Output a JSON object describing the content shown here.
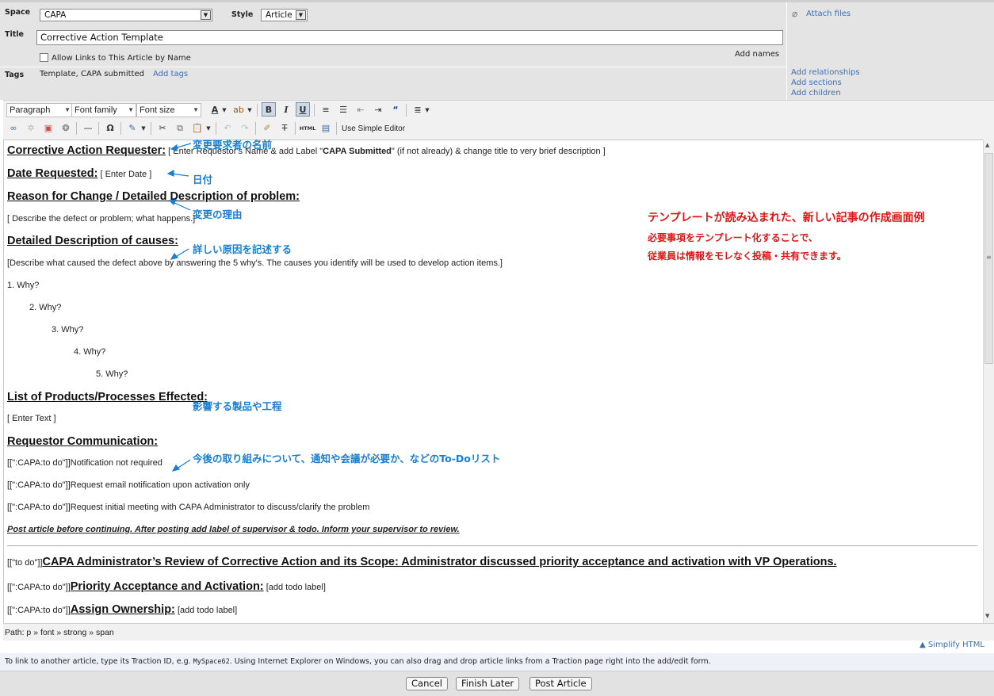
{
  "form": {
    "space_label": "Space",
    "space_value": "CAPA",
    "style_label": "Style",
    "style_value": "Article",
    "title_label": "Title",
    "title_value": "Corrective Action Template",
    "allow_links_label": "Allow Links to This Article by Name",
    "add_names": "Add names",
    "tags_label": "Tags",
    "tags_value": "Template, CAPA submitted",
    "add_tags": "Add tags",
    "attach_files": "Attach files",
    "add_relationships": "Add relationships",
    "add_sections": "Add sections",
    "add_children": "Add children"
  },
  "toolbar": {
    "paragraph": "Paragraph",
    "font_family": "Font family",
    "font_size": "Font size",
    "use_simple_editor": "Use Simple Editor",
    "html_label": "HTML"
  },
  "editor": {
    "requester_heading": "Corrective Action Requester:",
    "requester_hint_pre": "[ Enter Requestor's Name & add Label \"",
    "requester_hint_bold": "CAPA Submitted",
    "requester_hint_post": "\" (if not already) & change title to very brief description ]",
    "date_heading": "Date Requested:",
    "date_hint": "[ Enter Date ]",
    "reason_heading": "Reason for Change / Detailed Description of problem:",
    "reason_hint": "[ Describe the defect or problem; what happens.]",
    "causes_heading": "Detailed Description of causes:",
    "causes_hint": "[Describe what caused the defect above by answering the 5 why's. The causes you identify will be used to develop action items.]",
    "whys": [
      "1. Why?",
      "2. Why?",
      "3. Why?",
      "4. Why?",
      "5. Why?"
    ],
    "products_heading": "List of Products/Processes Effected:",
    "products_hint": "[ Enter Text ]",
    "communication_heading": "Requestor Communication:",
    "todo_prefix": "[[\":CAPA:to do\"]]",
    "todo_items": [
      "Notification not required",
      "Request email notification upon activation only",
      "Request initial meeting with CAPA Administrator to discuss/clarify the problem"
    ],
    "post_note": "Post article before continuing. After posting add label of supervisor & todo. Inform your supervisor to review.",
    "review_prefix": "[[\"to do\"]]",
    "review_heading": "CAPA Administrator’s Review of Corrective Action and its Scope: Administrator discussed priority acceptance and activation with VP Operations.",
    "priority_heading": "Priority Acceptance and Activation:",
    "priority_hint": "[add todo label]",
    "ownership_heading": "Assign Ownership:",
    "ownership_hint": "[add todo label]"
  },
  "annotations": {
    "requester_name": "変更要求者の名前",
    "date": "日付",
    "reason": "変更の理由",
    "causes": "詳しい原因を記述する",
    "products": "影響する製品や工程",
    "todo": "今後の取り組みについて、通知や会議が必要か、などのTo-Doリスト",
    "caption_title": "テンプレートが読み込まれた、新しい記事の作成画面例",
    "caption_line1": "必要事項をテンプレート化することで、",
    "caption_line2": "従業員は情報をモレなく投稿・共有できます。"
  },
  "footer": {
    "path": "Path: p » font » strong » span",
    "simplify": "▲ Simplify HTML",
    "hint_pre": "To link to another article, type its Traction ID, e.g. ",
    "hint_code": "MySpace62",
    "hint_post": ". Using Internet Explorer on Windows, you can also drag and drop article links from a Traction page right into the add/edit form.",
    "cancel": "Cancel",
    "finish_later": "Finish Later",
    "post_article": "Post Article"
  },
  "colors": {
    "annotation_blue": "#1a7ed2",
    "caption_red": "#e01414",
    "link_blue": "#3b6fb6"
  }
}
